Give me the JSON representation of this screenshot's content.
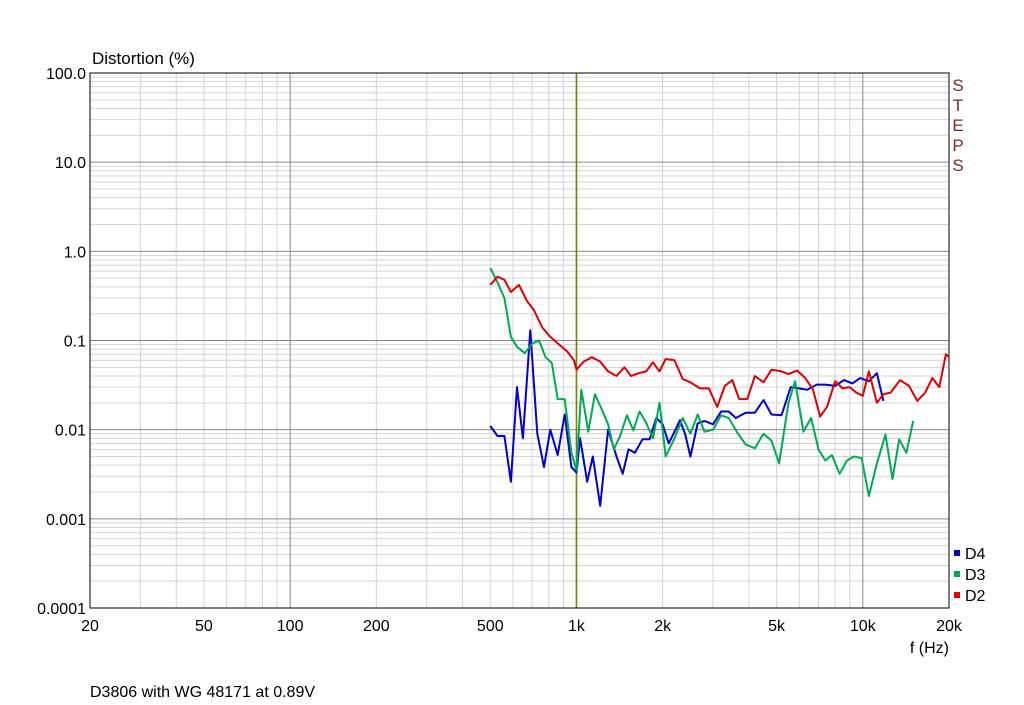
{
  "chart_data": {
    "type": "line",
    "title": "",
    "ylabel": "Distortion (%)",
    "xlabel": "f (Hz)",
    "footnote": "D3806 with WG 48171 at 0.89V",
    "watermark": "STEPS",
    "x_scale": "log",
    "y_scale": "log",
    "xlim": [
      20,
      20000
    ],
    "ylim": [
      0.0001,
      100
    ],
    "grid": true,
    "legend_position": "bottom-right",
    "x_ticks": [
      {
        "value": 20,
        "label": "20"
      },
      {
        "value": 50,
        "label": "50"
      },
      {
        "value": 100,
        "label": "100"
      },
      {
        "value": 200,
        "label": "200"
      },
      {
        "value": 500,
        "label": "500"
      },
      {
        "value": 1000,
        "label": "1k"
      },
      {
        "value": 2000,
        "label": "2k"
      },
      {
        "value": 5000,
        "label": "5k"
      },
      {
        "value": 10000,
        "label": "10k"
      },
      {
        "value": 20000,
        "label": "20k"
      }
    ],
    "y_ticks": [
      {
        "value": 100,
        "label": "100.0"
      },
      {
        "value": 10,
        "label": "10.0"
      },
      {
        "value": 1,
        "label": "1.0"
      },
      {
        "value": 0.1,
        "label": "0.1"
      },
      {
        "value": 0.01,
        "label": "0.01"
      },
      {
        "value": 0.001,
        "label": "0.001"
      },
      {
        "value": 0.0001,
        "label": "0.0001"
      }
    ],
    "reference_line_x": 1000,
    "reference_line_color": "#808000",
    "series": [
      {
        "name": "D4",
        "color": "#0000cc",
        "points": [
          [
            500,
            0.011
          ],
          [
            530,
            0.0085
          ],
          [
            560,
            0.0085
          ],
          [
            590,
            0.0026
          ],
          [
            620,
            0.03
          ],
          [
            650,
            0.008
          ],
          [
            690,
            0.13
          ],
          [
            730,
            0.009
          ],
          [
            770,
            0.0038
          ],
          [
            810,
            0.01
          ],
          [
            860,
            0.0052
          ],
          [
            910,
            0.0148
          ],
          [
            960,
            0.0038
          ],
          [
            1000,
            0.0033
          ],
          [
            1030,
            0.008
          ],
          [
            1090,
            0.0026
          ],
          [
            1140,
            0.005
          ],
          [
            1210,
            0.0014
          ],
          [
            1290,
            0.01
          ],
          [
            1380,
            0.005
          ],
          [
            1450,
            0.0032
          ],
          [
            1520,
            0.006
          ],
          [
            1600,
            0.0055
          ],
          [
            1700,
            0.0078
          ],
          [
            1800,
            0.0078
          ],
          [
            1900,
            0.0135
          ],
          [
            2000,
            0.0115
          ],
          [
            2100,
            0.007
          ],
          [
            2200,
            0.0095
          ],
          [
            2300,
            0.0128
          ],
          [
            2400,
            0.0088
          ],
          [
            2500,
            0.005
          ],
          [
            2650,
            0.0118
          ],
          [
            2800,
            0.0125
          ],
          [
            3000,
            0.0115
          ],
          [
            3200,
            0.016
          ],
          [
            3400,
            0.016
          ],
          [
            3600,
            0.0135
          ],
          [
            3900,
            0.0155
          ],
          [
            4200,
            0.0155
          ],
          [
            4500,
            0.0215
          ],
          [
            4800,
            0.0148
          ],
          [
            5200,
            0.0145
          ],
          [
            5600,
            0.03
          ],
          [
            6000,
            0.029
          ],
          [
            6400,
            0.028
          ],
          [
            6900,
            0.032
          ],
          [
            7400,
            0.032
          ],
          [
            8000,
            0.031
          ],
          [
            8600,
            0.036
          ],
          [
            9200,
            0.033
          ],
          [
            9800,
            0.038
          ],
          [
            10500,
            0.035
          ],
          [
            11200,
            0.043
          ],
          [
            11800,
            0.021
          ]
        ]
      },
      {
        "name": "D3",
        "color": "#00aa55",
        "points": [
          [
            500,
            0.65
          ],
          [
            530,
            0.45
          ],
          [
            560,
            0.3
          ],
          [
            590,
            0.11
          ],
          [
            620,
            0.085
          ],
          [
            660,
            0.072
          ],
          [
            700,
            0.092
          ],
          [
            740,
            0.1
          ],
          [
            780,
            0.065
          ],
          [
            820,
            0.056
          ],
          [
            860,
            0.022
          ],
          [
            910,
            0.022
          ],
          [
            960,
            0.0055
          ],
          [
            1000,
            0.0035
          ],
          [
            1040,
            0.028
          ],
          [
            1100,
            0.0095
          ],
          [
            1160,
            0.025
          ],
          [
            1230,
            0.0165
          ],
          [
            1290,
            0.0115
          ],
          [
            1350,
            0.006
          ],
          [
            1420,
            0.0085
          ],
          [
            1500,
            0.0145
          ],
          [
            1580,
            0.0098
          ],
          [
            1660,
            0.016
          ],
          [
            1750,
            0.012
          ],
          [
            1850,
            0.008
          ],
          [
            1950,
            0.02
          ],
          [
            2050,
            0.005
          ],
          [
            2200,
            0.008
          ],
          [
            2350,
            0.0135
          ],
          [
            2500,
            0.009
          ],
          [
            2650,
            0.0148
          ],
          [
            2800,
            0.0095
          ],
          [
            3000,
            0.01
          ],
          [
            3200,
            0.0145
          ],
          [
            3400,
            0.0135
          ],
          [
            3650,
            0.0092
          ],
          [
            3900,
            0.0068
          ],
          [
            4200,
            0.0062
          ],
          [
            4500,
            0.009
          ],
          [
            4800,
            0.0075
          ],
          [
            5100,
            0.0042
          ],
          [
            5500,
            0.02
          ],
          [
            5800,
            0.035
          ],
          [
            6200,
            0.0095
          ],
          [
            6600,
            0.0135
          ],
          [
            7000,
            0.006
          ],
          [
            7400,
            0.0045
          ],
          [
            7800,
            0.0052
          ],
          [
            8300,
            0.0032
          ],
          [
            8800,
            0.0045
          ],
          [
            9300,
            0.005
          ],
          [
            9900,
            0.0048
          ],
          [
            10500,
            0.0018
          ],
          [
            11200,
            0.0042
          ],
          [
            12000,
            0.0088
          ],
          [
            12700,
            0.0028
          ],
          [
            13400,
            0.0078
          ],
          [
            14200,
            0.0055
          ],
          [
            15000,
            0.0125
          ]
        ]
      },
      {
        "name": "D2",
        "color": "#dd0000",
        "points": [
          [
            500,
            0.42
          ],
          [
            530,
            0.52
          ],
          [
            560,
            0.48
          ],
          [
            590,
            0.35
          ],
          [
            630,
            0.42
          ],
          [
            670,
            0.28
          ],
          [
            710,
            0.22
          ],
          [
            760,
            0.14
          ],
          [
            810,
            0.11
          ],
          [
            870,
            0.09
          ],
          [
            930,
            0.075
          ],
          [
            980,
            0.06
          ],
          [
            1000,
            0.047
          ],
          [
            1060,
            0.058
          ],
          [
            1130,
            0.065
          ],
          [
            1210,
            0.058
          ],
          [
            1290,
            0.045
          ],
          [
            1380,
            0.04
          ],
          [
            1470,
            0.05
          ],
          [
            1550,
            0.04
          ],
          [
            1650,
            0.043
          ],
          [
            1750,
            0.045
          ],
          [
            1850,
            0.057
          ],
          [
            1950,
            0.045
          ],
          [
            2050,
            0.062
          ],
          [
            2200,
            0.06
          ],
          [
            2350,
            0.037
          ],
          [
            2500,
            0.034
          ],
          [
            2700,
            0.029
          ],
          [
            2900,
            0.029
          ],
          [
            3100,
            0.018
          ],
          [
            3300,
            0.031
          ],
          [
            3500,
            0.036
          ],
          [
            3700,
            0.022
          ],
          [
            3950,
            0.022
          ],
          [
            4200,
            0.04
          ],
          [
            4500,
            0.034
          ],
          [
            4800,
            0.047
          ],
          [
            5200,
            0.045
          ],
          [
            5500,
            0.042
          ],
          [
            5900,
            0.046
          ],
          [
            6300,
            0.038
          ],
          [
            6700,
            0.028
          ],
          [
            7100,
            0.014
          ],
          [
            7500,
            0.018
          ],
          [
            8000,
            0.035
          ],
          [
            8500,
            0.029
          ],
          [
            9000,
            0.03
          ],
          [
            9500,
            0.026
          ],
          [
            10000,
            0.024
          ],
          [
            10500,
            0.045
          ],
          [
            11200,
            0.02
          ],
          [
            11800,
            0.025
          ],
          [
            12500,
            0.026
          ],
          [
            13500,
            0.036
          ],
          [
            14500,
            0.031
          ],
          [
            15500,
            0.021
          ],
          [
            16500,
            0.026
          ],
          [
            17500,
            0.038
          ],
          [
            18500,
            0.03
          ],
          [
            19500,
            0.07
          ],
          [
            20000,
            0.065
          ]
        ]
      }
    ]
  }
}
